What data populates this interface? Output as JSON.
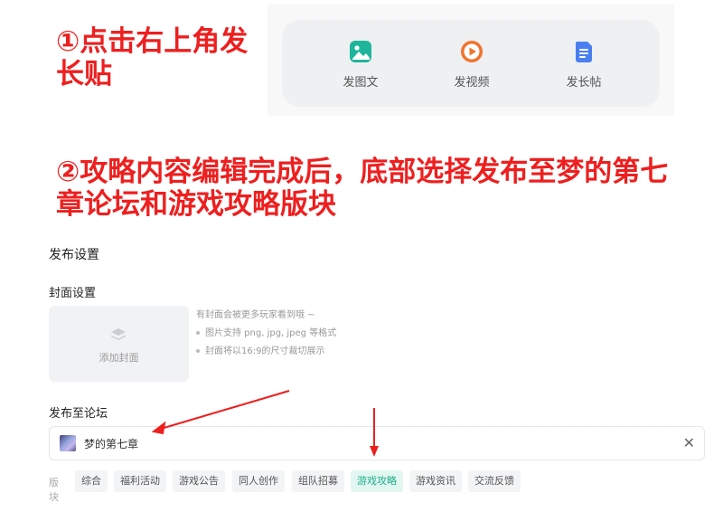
{
  "instructions": {
    "step1": "①点击右上角发长贴",
    "step2": "②攻略内容编辑完成后，底部选择发布至梦的第七章论坛和游戏攻略版块"
  },
  "post_buttons": [
    {
      "label": "发图文",
      "icon": "image-icon",
      "color": "#1fb59a"
    },
    {
      "label": "发视频",
      "icon": "video-play-icon",
      "color": "#f0742e"
    },
    {
      "label": "发长帖",
      "icon": "document-icon",
      "color": "#4a7ff0"
    }
  ],
  "publish": {
    "title": "发布设置",
    "cover": {
      "title": "封面设置",
      "add_label": "添加封面",
      "hint": "有封面会被更多玩家看到哦 ~",
      "tips": [
        "图片支持 png, jpg, jpeg 等格式",
        "封面将以16:9的尺寸裁切展示"
      ]
    },
    "forum": {
      "title": "发布至论坛",
      "selected": "梦的第七章",
      "clear": "✕"
    },
    "boards": {
      "label": "版块",
      "items": [
        "综合",
        "福利活动",
        "游戏公告",
        "同人创作",
        "组队招募",
        "游戏攻略",
        "游戏资讯",
        "交流反馈"
      ],
      "active": "游戏攻略"
    }
  },
  "colors": {
    "annotation": "#ee1f1f",
    "active_chip_bg": "#e2f7f1",
    "active_chip_text": "#1fae8c"
  }
}
